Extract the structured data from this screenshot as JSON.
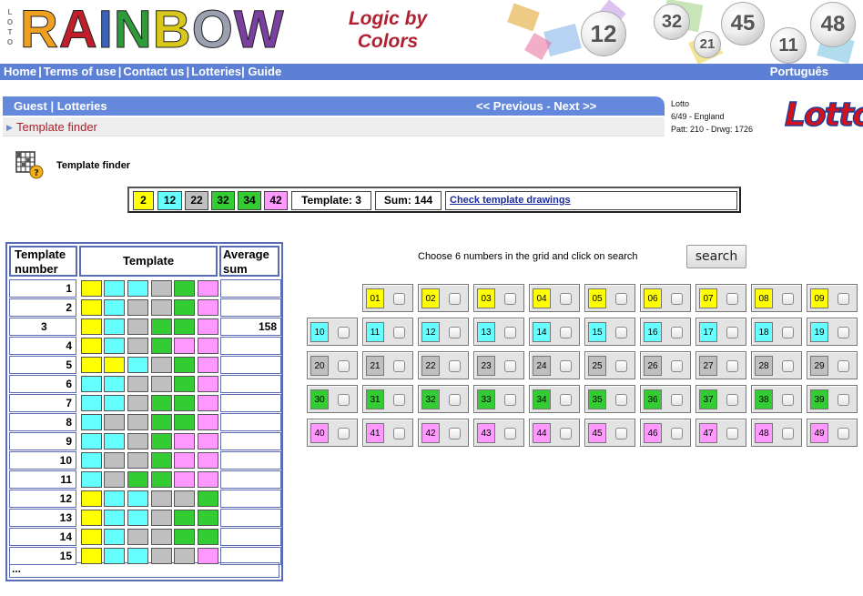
{
  "header": {
    "vertical_text": "LOTO",
    "brand_letters": [
      "R",
      "A",
      "I",
      "N",
      "B",
      "O",
      "W"
    ],
    "brand_colors": [
      "#f0a020",
      "#c01e2a",
      "#3a63b8",
      "#2f9a3a",
      "#d8c81a",
      "#9aa0b0",
      "#7a3fa0"
    ],
    "tagline_line1": "Logic by",
    "tagline_line2": "Colors",
    "decor_balls": [
      "12",
      "32",
      "21",
      "45",
      "11",
      "48"
    ]
  },
  "nav": {
    "links": [
      "Home",
      "Terms of use",
      "Contact us",
      "Lotteries",
      "Guide"
    ],
    "language": "Português"
  },
  "breadcrumb": {
    "guest": "Guest",
    "lotteries": "Lotteries",
    "previous": "<< Previous",
    "next": "Next >>",
    "current": "Template finder"
  },
  "lottery_info": {
    "name": "Lotto",
    "format": "6/49 - England",
    "patt_drwg": "Patt: 210 - Drwg: 1726",
    "logo_text": "Lotto"
  },
  "page": {
    "title": "Template finder",
    "icon": "template-grid-icon"
  },
  "summary": {
    "numbers": [
      "2",
      "12",
      "22",
      "32",
      "34",
      "42"
    ],
    "template_label": "Template: 3",
    "sum_label": "Sum: 144",
    "link": "Check template drawings"
  },
  "colors": {
    "yellow": "#ffff00",
    "cyan": "#66ffff",
    "grey": "#bfbfbf",
    "green": "#33cc33",
    "pink": "#ff99ff",
    "nav_blue": "#5b80d5"
  },
  "template_table": {
    "headers": {
      "number": "Template number",
      "template": "Template",
      "avg": "Average sum"
    },
    "rows": [
      {
        "num": "1",
        "cells": [
          "yellow",
          "cyan",
          "cyan",
          "grey",
          "green",
          "pink"
        ],
        "avg": ""
      },
      {
        "num": "2",
        "cells": [
          "yellow",
          "cyan",
          "grey",
          "grey",
          "green",
          "pink"
        ],
        "avg": ""
      },
      {
        "num": "3",
        "cells": [
          "yellow",
          "cyan",
          "grey",
          "green",
          "green",
          "pink"
        ],
        "avg": "158"
      },
      {
        "num": "4",
        "cells": [
          "yellow",
          "cyan",
          "grey",
          "green",
          "pink",
          "pink"
        ],
        "avg": ""
      },
      {
        "num": "5",
        "cells": [
          "yellow",
          "yellow",
          "cyan",
          "grey",
          "green",
          "pink"
        ],
        "avg": ""
      },
      {
        "num": "6",
        "cells": [
          "cyan",
          "cyan",
          "grey",
          "grey",
          "green",
          "pink"
        ],
        "avg": ""
      },
      {
        "num": "7",
        "cells": [
          "cyan",
          "cyan",
          "grey",
          "green",
          "green",
          "pink"
        ],
        "avg": ""
      },
      {
        "num": "8",
        "cells": [
          "cyan",
          "grey",
          "grey",
          "green",
          "green",
          "pink"
        ],
        "avg": ""
      },
      {
        "num": "9",
        "cells": [
          "cyan",
          "cyan",
          "grey",
          "green",
          "pink",
          "pink"
        ],
        "avg": ""
      },
      {
        "num": "10",
        "cells": [
          "cyan",
          "grey",
          "grey",
          "green",
          "pink",
          "pink"
        ],
        "avg": ""
      },
      {
        "num": "11",
        "cells": [
          "cyan",
          "grey",
          "green",
          "green",
          "pink",
          "pink"
        ],
        "avg": ""
      },
      {
        "num": "12",
        "cells": [
          "yellow",
          "cyan",
          "cyan",
          "grey",
          "grey",
          "green"
        ],
        "avg": ""
      },
      {
        "num": "13",
        "cells": [
          "yellow",
          "cyan",
          "cyan",
          "grey",
          "green",
          "green"
        ],
        "avg": ""
      },
      {
        "num": "14",
        "cells": [
          "yellow",
          "cyan",
          "grey",
          "grey",
          "green",
          "green"
        ],
        "avg": ""
      },
      {
        "num": "15",
        "cells": [
          "yellow",
          "cyan",
          "cyan",
          "grey",
          "grey",
          "pink"
        ],
        "avg": ""
      }
    ],
    "more": "..."
  },
  "grid": {
    "instruction": "Choose 6 numbers in the grid and click on search",
    "search_label": "search",
    "rows": [
      {
        "color": "yellow",
        "numbers": [
          "01",
          "02",
          "03",
          "04",
          "05",
          "06",
          "07",
          "08",
          "09"
        ]
      },
      {
        "color": "cyan",
        "numbers": [
          "10",
          "11",
          "12",
          "13",
          "14",
          "15",
          "16",
          "17",
          "18",
          "19"
        ]
      },
      {
        "color": "grey",
        "numbers": [
          "20",
          "21",
          "22",
          "23",
          "24",
          "25",
          "26",
          "27",
          "28",
          "29"
        ]
      },
      {
        "color": "green",
        "numbers": [
          "30",
          "31",
          "32",
          "33",
          "34",
          "35",
          "36",
          "37",
          "38",
          "39"
        ]
      },
      {
        "color": "pink",
        "numbers": [
          "40",
          "41",
          "42",
          "43",
          "44",
          "45",
          "46",
          "47",
          "48",
          "49"
        ]
      }
    ]
  }
}
